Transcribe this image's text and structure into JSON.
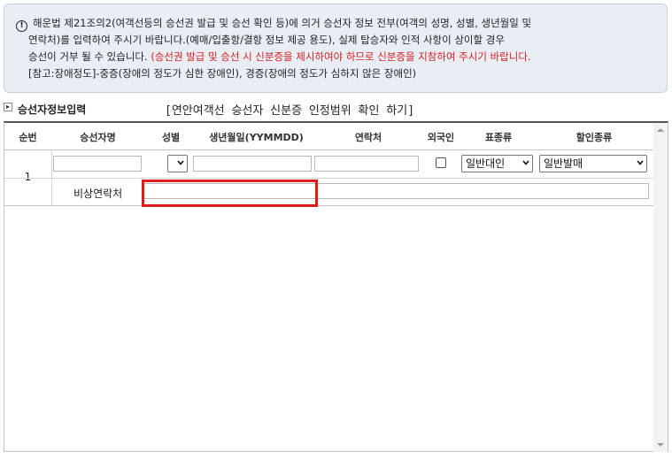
{
  "notice": {
    "line1": "해운법 제21조의2(여객선등의 승선권 발급 및 승선 확인 등)에 의거 승선자 정보 전부(여객의 성명, 성별, 생년월일 및",
    "line2": "연락처)를 입력하여 주시기 바랍니다.(예매/입출항/결항 정보 제공 용도), 실제 탑승자와 인적 사항이 상이할 경우",
    "line3_black": "승선이 거부 될 수 있습니다.",
    "line3_red": "(승선권 발급 및 승선 시 신분증을 제시하여야 하므로 신분증을 지참하여 주시기 바랍니다.",
    "line4": "[참고:장애정도]-중증(장애의 정도가 심한 장애인), 경증(장애의 정도가 심하지 않은 장애인)"
  },
  "section": {
    "toggle": "▸",
    "title": "승선자정보입력",
    "link": "[연안여객선 승선자 신분증 인정범위 확인 하기]"
  },
  "table": {
    "headers": [
      "순번",
      "승선자명",
      "성별",
      "생년월일(YYMMDD)",
      "연락처",
      "외국인",
      "표종류",
      "할인종류"
    ],
    "rows": [
      {
        "number": "1",
        "name": "",
        "gender": "",
        "birthdate": "",
        "contact": "",
        "foreigner": false,
        "ticket_type": "일반대인",
        "discount_type": "일반발매",
        "emergency_label": "비상연락처",
        "emergency_contact": ""
      }
    ]
  },
  "colors": {
    "notice_bg": "#e9eef5",
    "warning_red": "#d42020",
    "highlight_red": "#e01b1b"
  }
}
